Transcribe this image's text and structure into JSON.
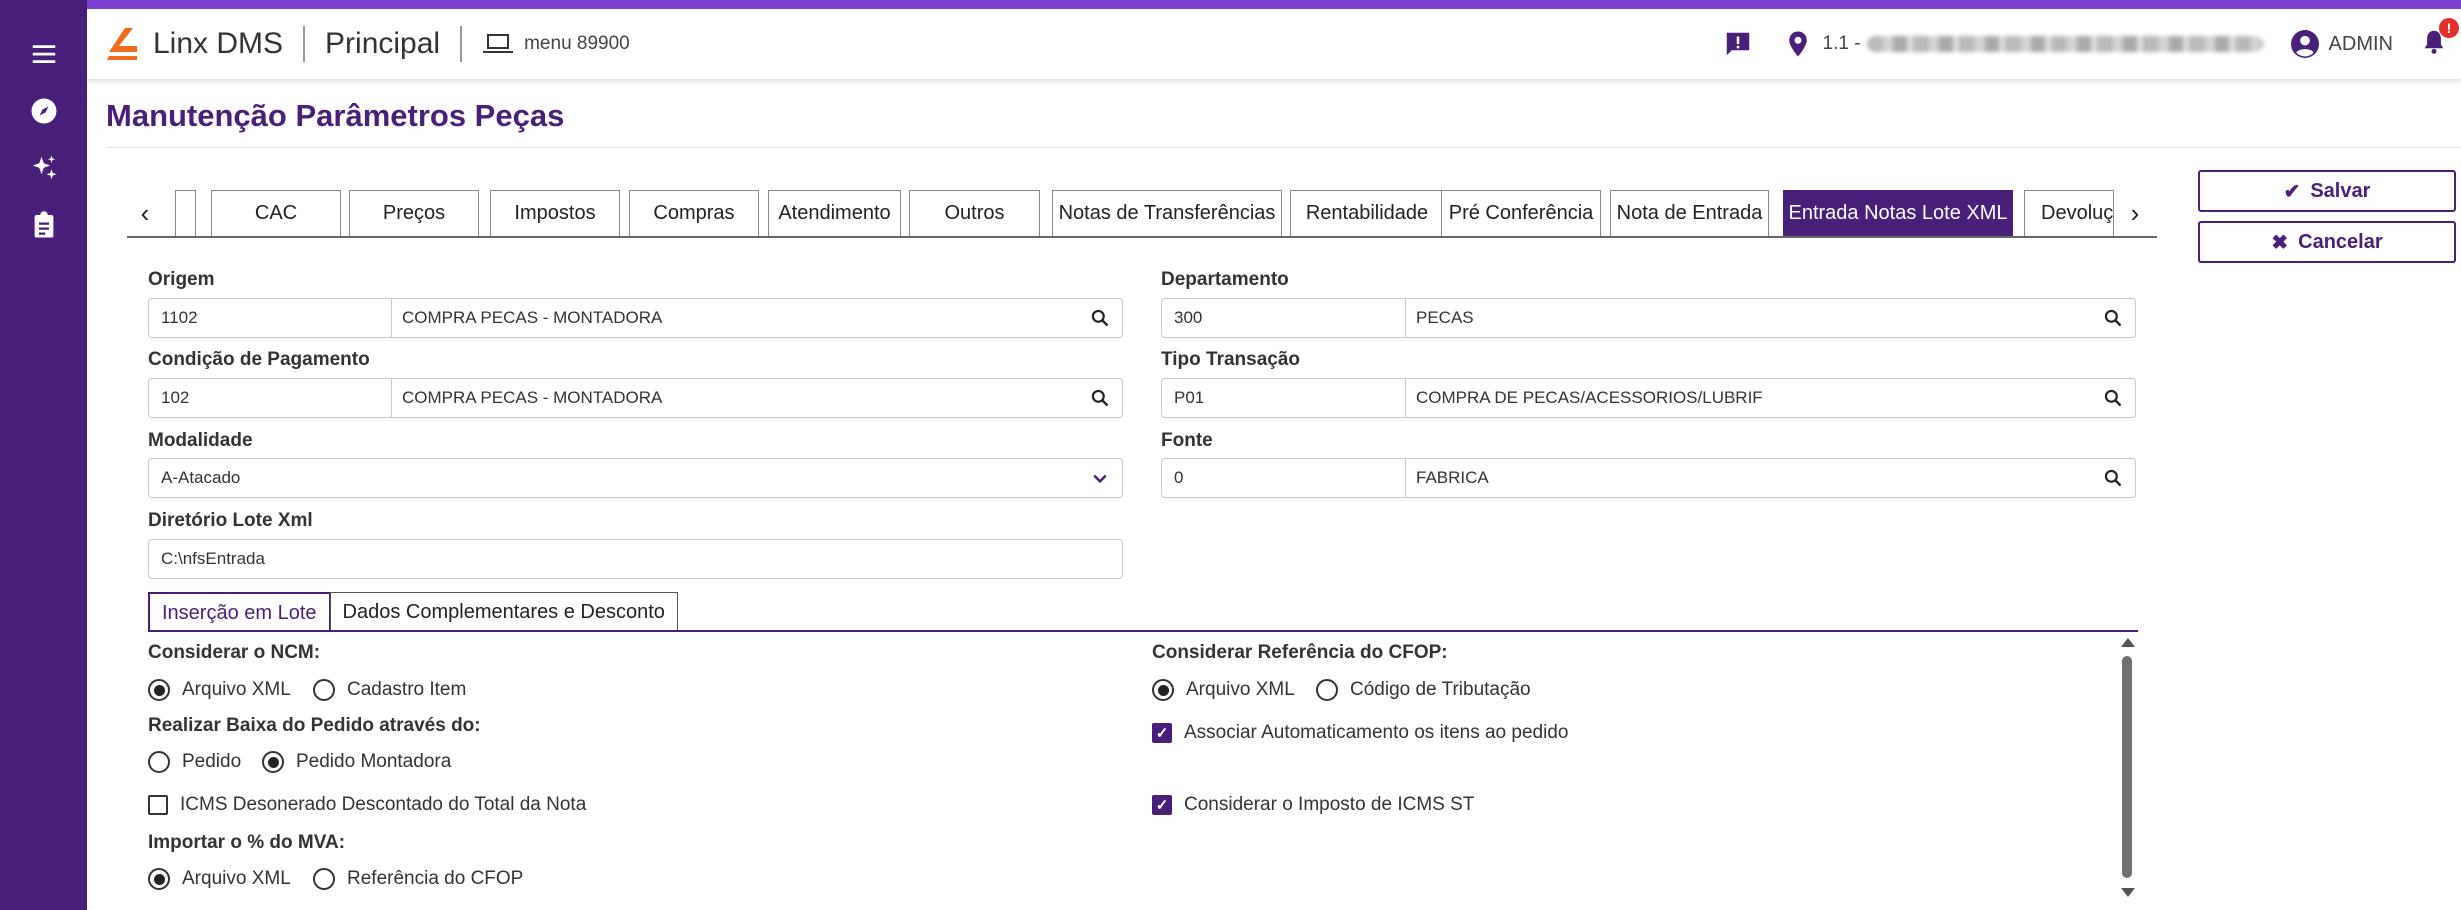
{
  "app": {
    "brand": "Linx DMS",
    "module": "Principal",
    "menu_code": "menu 89900"
  },
  "header": {
    "branch_prefix": "1.1 -",
    "user": "ADMIN",
    "notification_badge": "!"
  },
  "icons": {
    "sidebar": [
      "menu-icon",
      "compass-icon",
      "sparkles-icon",
      "clipboard-icon"
    ],
    "header": [
      "message-alert-icon",
      "location-pin-icon",
      "user-circle-icon",
      "bell-icon"
    ]
  },
  "colors": {
    "primary": "#4a1f7a",
    "accent_orange": "#f26b1d",
    "stripe": "#7e3fd0"
  },
  "page": {
    "title": "Manutenção Parâmetros Peças"
  },
  "tabs": {
    "prev": "‹",
    "next": "›",
    "items": [
      "",
      "CAC",
      "Preços",
      "Impostos",
      "Compras",
      "Atendimento",
      "Outros",
      "Notas de Transferências",
      "Rentabilidade",
      "Pré Conferência",
      "Nota de Entrada",
      "Entrada Notas Lote XML",
      "Devoluç"
    ],
    "active": "Entrada Notas Lote XML"
  },
  "actions": {
    "save": "Salvar",
    "cancel": "Cancelar"
  },
  "form": {
    "origem": {
      "label": "Origem",
      "code": "1102",
      "desc": "COMPRA PECAS - MONTADORA"
    },
    "departamento": {
      "label": "Departamento",
      "code": "300",
      "desc": "PECAS"
    },
    "condicao": {
      "label": "Condição de Pagamento",
      "code": "102",
      "desc": "COMPRA PECAS - MONTADORA"
    },
    "tipo_transacao": {
      "label": "Tipo Transação",
      "code": "P01",
      "desc": "COMPRA DE PECAS/ACESSORIOS/LUBRIF"
    },
    "modalidade": {
      "label": "Modalidade",
      "value": "A-Atacado"
    },
    "fonte": {
      "label": "Fonte",
      "code": "0",
      "desc": "FABRICA"
    },
    "diretorio": {
      "label": "Diretório Lote Xml",
      "value": "C:\\nfsEntrada"
    }
  },
  "subtabs": {
    "items": [
      "Inserção em Lote",
      "Dados Complementares e Desconto"
    ],
    "active": "Inserção em Lote"
  },
  "lote": {
    "ncm": {
      "label": "Considerar o NCM:",
      "options": [
        "Arquivo XML",
        "Cadastro Item"
      ],
      "selected": "Arquivo XML"
    },
    "baixa": {
      "label": "Realizar Baixa do Pedido através do:",
      "options": [
        "Pedido",
        "Pedido Montadora"
      ],
      "selected": "Pedido Montadora"
    },
    "icms_desonerado": {
      "label": "ICMS Desonerado Descontado do Total da Nota",
      "checked": false
    },
    "mva": {
      "label": "Importar o % do MVA:",
      "options": [
        "Arquivo XML",
        "Referência do CFOP"
      ],
      "selected": "Arquivo XML"
    },
    "cfop": {
      "label": "Considerar Referência do CFOP:",
      "options": [
        "Arquivo XML",
        "Código de Tributação"
      ],
      "selected": "Arquivo XML"
    },
    "associar": {
      "label": "Associar Automaticamento os itens ao pedido",
      "checked": true
    },
    "icms_st": {
      "label": "Considerar o Imposto de ICMS ST",
      "checked": true
    }
  }
}
